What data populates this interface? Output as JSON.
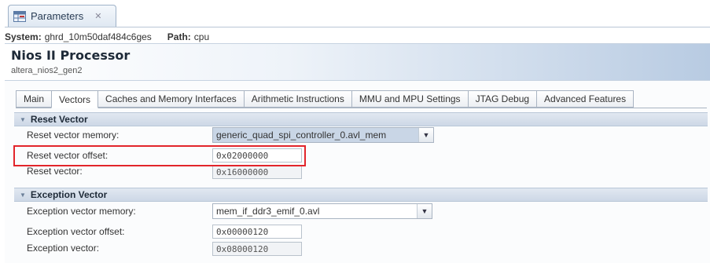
{
  "view": {
    "tab_title": "Parameters",
    "close_glyph": "✕",
    "icon": "parameters-grid-icon"
  },
  "system": {
    "label": "System:",
    "value": "ghrd_10m50daf484c6ges",
    "path_label": "Path:",
    "path_value": "cpu"
  },
  "component": {
    "title": "Nios II Processor",
    "subtitle": "altera_nios2_gen2"
  },
  "tabs": [
    {
      "label": "Main",
      "active": false
    },
    {
      "label": "Vectors",
      "active": true
    },
    {
      "label": "Caches and Memory Interfaces",
      "active": false
    },
    {
      "label": "Arithmetic Instructions",
      "active": false
    },
    {
      "label": "MMU and MPU Settings",
      "active": false
    },
    {
      "label": "JTAG Debug",
      "active": false
    },
    {
      "label": "Advanced Features",
      "active": false
    }
  ],
  "reset_section": {
    "title": "Reset Vector",
    "memory_label": "Reset vector memory:",
    "memory_value": "generic_quad_spi_controller_0.avl_mem",
    "offset_label": "Reset vector offset:",
    "offset_value": "0x02000000",
    "vector_label": "Reset vector:",
    "vector_value": "0x16000000"
  },
  "exception_section": {
    "title": "Exception Vector",
    "memory_label": "Exception vector memory:",
    "memory_value": "mem_if_ddr3_emif_0.avl",
    "offset_label": "Exception vector offset:",
    "offset_value": "0x00000120",
    "vector_label": "Exception vector:",
    "vector_value": "0x08000120"
  },
  "colors": {
    "highlight": "#e2252b",
    "header_gradient_end": "#b8cbe2",
    "section_header": "#cdd8e6"
  }
}
